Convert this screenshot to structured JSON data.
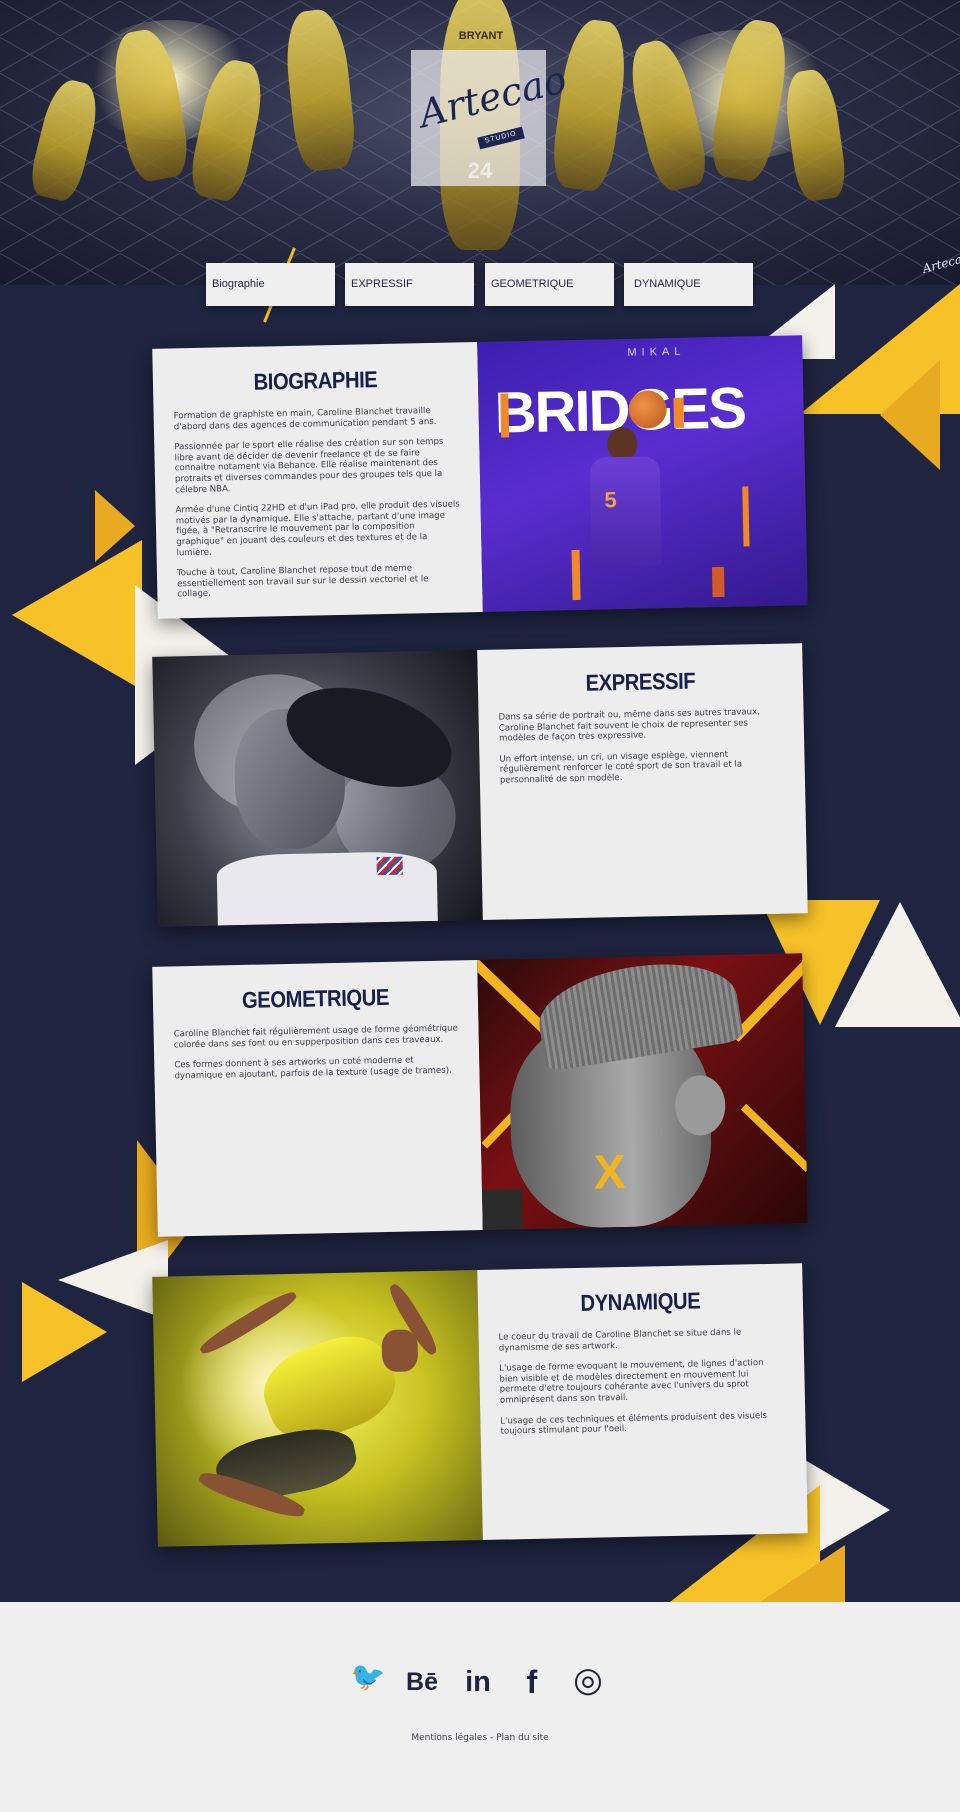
{
  "hero": {
    "logo_text": "Artecao",
    "logo_sub": "STUDIO",
    "signature": "Artecao",
    "jersey_name": "BRYANT",
    "jersey_number": "24"
  },
  "nav": {
    "items": [
      {
        "label": "Biographie"
      },
      {
        "label": "EXPRESSIF"
      },
      {
        "label": "GEOMETRIQUE"
      },
      {
        "label": "DYNAMIQUE"
      }
    ]
  },
  "sections": {
    "biographie": {
      "title": "BIOGRAPHIE",
      "paragraphs": [
        "Formation de graphiste en main, Caroline Blanchet travaille d'abord dans des agences de communication pendant 5 ans.",
        "Passionnée par le sport elle réalise des création sur son temps libre avant de décider de devenir freelance et de se faire connaitre notament via Behance. Elle réalise maintenant des protraits et diverses commandes pour des groupes tels que la célebre NBA.",
        "Armée d'une Cintiq 22HD et d'un iPad pro, elle produit des visuels motivés par la dynamique. Elle s'attache, partant d'une image figée, à \"Retranscrire le mouvement par la composition graphique\" en jouant des couleurs et des textures et de la lumière.",
        "Touche à tout, Caroline Blanchet repose tout de meme essentiellement son travail sur sur le dessin vectoriel et le collage."
      ],
      "image_text_top": "MIKAL",
      "image_text_big": "BRIDGES",
      "image_jersey": "5"
    },
    "expressif": {
      "title": "EXPRESSIF",
      "paragraphs": [
        "Dans sa série de portrait ou, même dans ses autres travaux, Caroline Blanchet fait souvent le choix de representer ses modèles de façon très expressive.",
        "Un effort intense, un cri, un visage espiège, viennent régulièrement renforcer le coté sport de son travail et la personnalité de son modèle."
      ]
    },
    "geometrique": {
      "title": "GEOMETRIQUE",
      "paragraphs": [
        "Caroline Blanchet fait régulièrement usage de forme géométrique colorée dans ses font ou en supperposition dans ces traveaux.",
        "Ces formes donnent à ses artworks un coté moderne et dynamique en ajoutant, parfois de la texture (usage de trames)."
      ],
      "image_mark": "X"
    },
    "dynamique": {
      "title": "DYNAMIQUE",
      "paragraphs": [
        "Le coeur du travail de Caroline Blanchet se situe dans le dynamisme de ses artwork.",
        "L'usage de forme evoquant le mouvement, de lignes d'action bien visible et de modèles directement en mouvement lui permete d'etre toujours cohérante avec l'univers du sprot omniprésent dans son travail.",
        "L'usage de ces techniques et éléments produisent des visuels toujours stimulant pour l'oeil."
      ]
    }
  },
  "footer": {
    "social": [
      {
        "icon": "twitter-icon",
        "glyph": "🐦"
      },
      {
        "icon": "behance-icon",
        "glyph": "Bē"
      },
      {
        "icon": "linkedin-icon",
        "glyph": "in"
      },
      {
        "icon": "facebook-icon",
        "glyph": "f"
      },
      {
        "icon": "instagram-icon",
        "glyph": "◎"
      }
    ],
    "links_text": "Mentions légales - Plan du site"
  },
  "colors": {
    "navy": "#16204a",
    "background": "#1f2440",
    "yellow": "#f7c228",
    "cream": "#f4f1ea",
    "card": "#ededee"
  }
}
